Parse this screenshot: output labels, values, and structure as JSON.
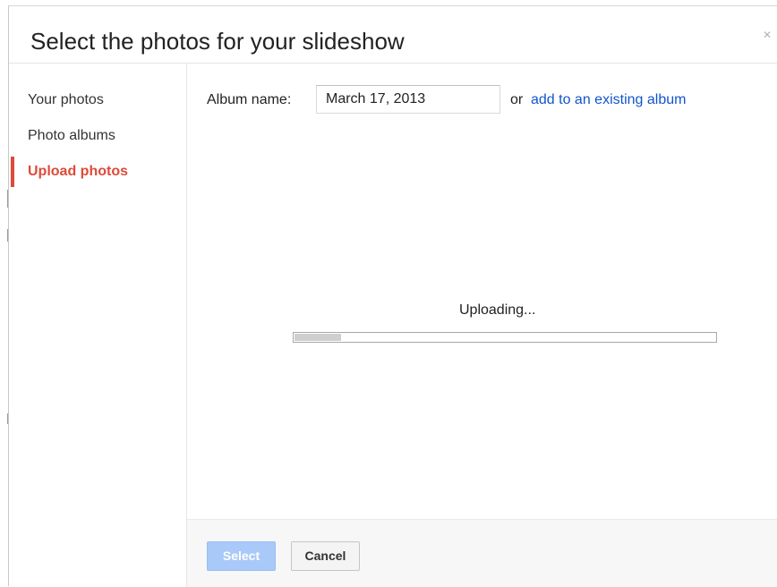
{
  "dialog": {
    "title": "Select the photos for your slideshow",
    "close_icon": "close-icon"
  },
  "sidebar": {
    "items": [
      {
        "label": "Your photos",
        "active": false
      },
      {
        "label": "Photo albums",
        "active": false
      },
      {
        "label": "Upload photos",
        "active": true
      }
    ]
  },
  "album": {
    "label": "Album name:",
    "value": "March 17, 2013",
    "or_text": "or",
    "link_text": "add to an existing album"
  },
  "upload": {
    "status": "Uploading...",
    "progress": 0.11
  },
  "footer": {
    "select_label": "Select",
    "cancel_label": "Cancel"
  },
  "colors": {
    "accent_red": "#dd4b39",
    "link_blue": "#1155cc",
    "select_button_disabled": "#a9c9f9"
  }
}
